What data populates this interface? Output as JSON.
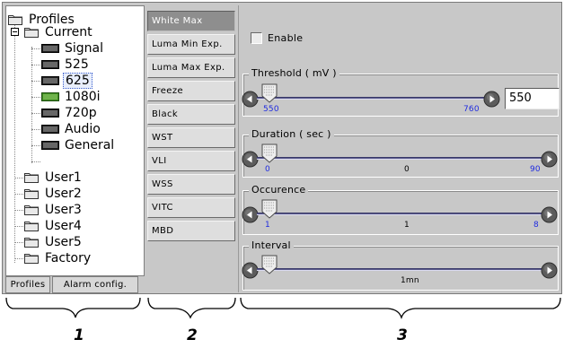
{
  "tree": {
    "root_label": "Profiles",
    "items": [
      {
        "label": "Current",
        "kind": "folder"
      },
      {
        "label": "Signal",
        "kind": "device"
      },
      {
        "label": "525",
        "kind": "device"
      },
      {
        "label": "625",
        "kind": "device",
        "selected": true
      },
      {
        "label": "1080i",
        "kind": "device-active"
      },
      {
        "label": "720p",
        "kind": "device"
      },
      {
        "label": "Audio",
        "kind": "device"
      },
      {
        "label": "General",
        "kind": "device"
      },
      {
        "label": "User1",
        "kind": "folder"
      },
      {
        "label": "User2",
        "kind": "folder"
      },
      {
        "label": "User3",
        "kind": "folder"
      },
      {
        "label": "User4",
        "kind": "folder"
      },
      {
        "label": "User5",
        "kind": "folder"
      },
      {
        "label": "Factory",
        "kind": "folder"
      }
    ],
    "tabs": [
      "Profiles",
      "Alarm config."
    ]
  },
  "functions": {
    "buttons": [
      "White Max",
      "Luma Min Exp.",
      "Luma Max Exp.",
      "Freeze",
      "Black",
      "WST",
      "VLI",
      "WSS",
      "VITC",
      "MBD"
    ],
    "active": "White Max"
  },
  "settings": {
    "enable_label": "Enable",
    "enable_checked": false,
    "threshold": {
      "title": "Threshold ( mV )",
      "min_label": "550",
      "max_label": "760",
      "value": "550"
    },
    "duration": {
      "title": "Duration ( sec )",
      "min_label": "0",
      "mid_label": "0",
      "max_label": "90"
    },
    "occurence": {
      "title": "Occurence",
      "min_label": "1",
      "mid_label": "1",
      "max_label": "8"
    },
    "interval": {
      "title": "Interval",
      "mid_label": "1mn"
    }
  },
  "callouts": [
    "1",
    "2",
    "3"
  ],
  "colors": {
    "panel_bg": "#c8c8c8",
    "active_button": "#8e8e8e",
    "tick_blue": "#1f2be0",
    "device_active": "#4caf2a"
  }
}
